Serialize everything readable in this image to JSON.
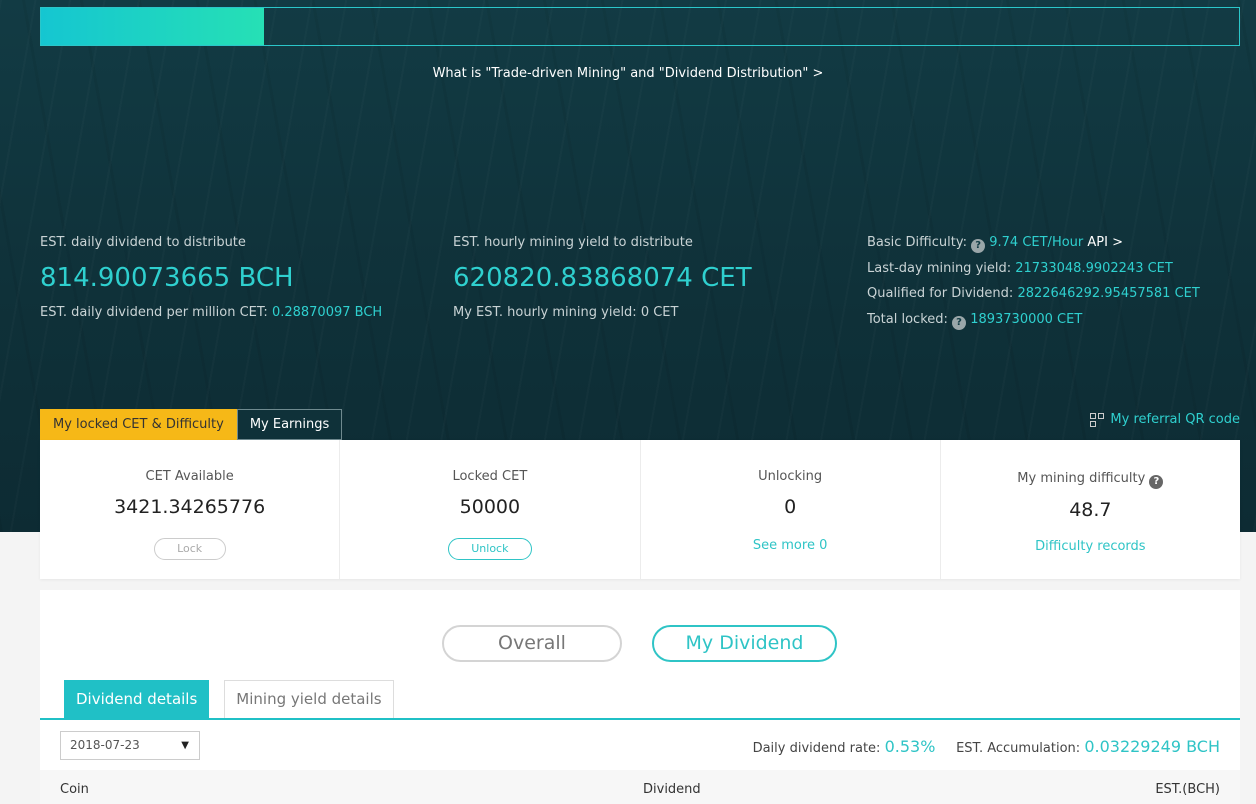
{
  "progress": {
    "fraction": 0.186
  },
  "hero": {
    "what_link": "What is \"Trade-driven Mining\" and \"Dividend Distribution\" >",
    "dividend": {
      "label": "EST. daily dividend to distribute",
      "value": "814.90073665 BCH",
      "sub_label": "EST. daily dividend per million CET:",
      "sub_value": "0.28870097 BCH"
    },
    "mining": {
      "label": "EST. hourly mining yield to distribute",
      "value": "620820.83868074 CET",
      "sub_label": "My EST. hourly mining yield: 0 CET"
    },
    "difficulty": {
      "basic_label": "Basic Difficulty:",
      "basic_value": "9.74 CET/Hour",
      "api_link": "API >",
      "lastday_label": "Last-day mining yield:",
      "lastday_value": "21733048.9902243 CET",
      "qualified_label": "Qualified for Dividend:",
      "qualified_value": "2822646292.95457581 CET",
      "locked_label": "Total locked:",
      "locked_value": "1893730000 CET"
    }
  },
  "tabs": {
    "locked": "My locked CET & Difficulty",
    "earnings": "My Earnings"
  },
  "qr_link": "My referral QR code",
  "cards": {
    "available": {
      "label": "CET Available",
      "value": "3421.34265776",
      "button": "Lock"
    },
    "locked": {
      "label": "Locked CET",
      "value": "50000",
      "button": "Unlock"
    },
    "unlocking": {
      "label": "Unlocking",
      "value": "0",
      "link": "See more 0"
    },
    "difficulty": {
      "label": "My mining difficulty",
      "value": "48.7",
      "link": "Difficulty records"
    }
  },
  "segment": {
    "overall": "Overall",
    "my_dividend": "My Dividend"
  },
  "subtabs": {
    "dividend": "Dividend details",
    "mining": "Mining yield details"
  },
  "date_select": {
    "value": "2018-07-23",
    "arrow": "▼"
  },
  "rates": {
    "daily_label": "Daily dividend rate:",
    "daily_value": "0.53%",
    "accum_label": "EST. Accumulation:",
    "accum_value": "0.03229249 BCH"
  },
  "table": {
    "columns": [
      "Coin",
      "Dividend",
      "EST.(BCH)"
    ]
  },
  "icons": {
    "help": "question-circle-icon",
    "qr": "qr-code-icon",
    "dropdown": "caret-down-icon"
  },
  "colors": {
    "accent": "#2fd0cf",
    "tab_active": "#f6b817",
    "hero_bg": "#123b44"
  }
}
